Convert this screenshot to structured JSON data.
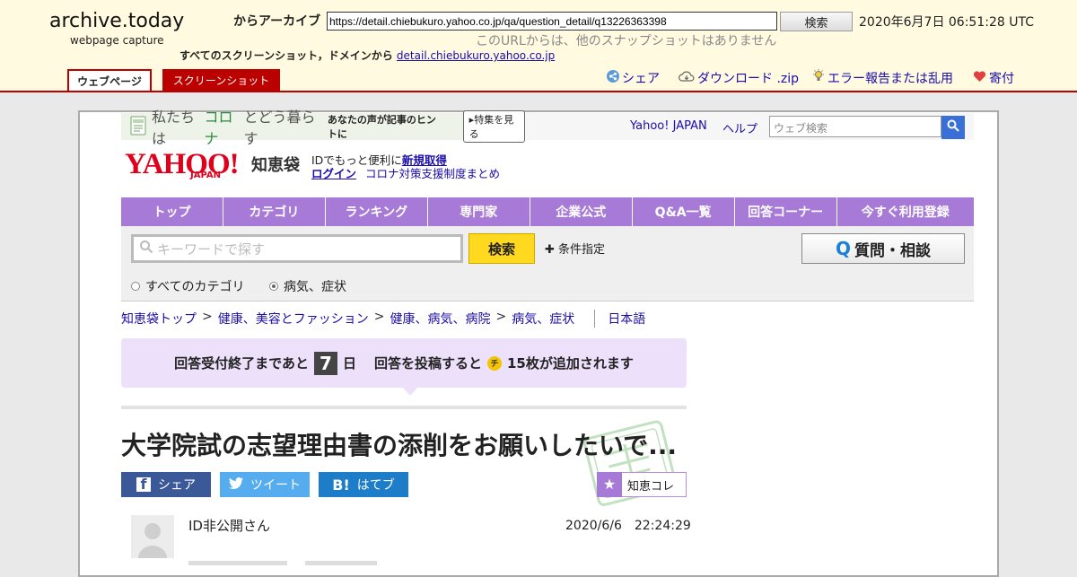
{
  "archive": {
    "logo": "archive.today",
    "logo_sub": "webpage capture",
    "from_label": "からアーカイブ",
    "url_value": "https://detail.chiebukuro.yahoo.co.jp/qa/question_detail/q13226363398",
    "search_label": "検索",
    "capture_date": "2020年6月7日 06:51:28 UTC",
    "no_other_snapshots": "このURLからは、他のスナップショットはありません",
    "all_screenshots_label": "すべてのスクリーンショット，ドメインから",
    "domain_link": "detail.chiebukuro.yahoo.co.jp",
    "tab_webpage": "ウェブページ",
    "tab_screenshot": "スクリーンショット",
    "actions": {
      "share": "シェア",
      "download": "ダウンロード .zip",
      "report": "エラー報告または乱用",
      "donate": "寄付"
    }
  },
  "yahoo": {
    "corona_banner": {
      "prefix": "私たちは",
      "corona": "コロナ",
      "middle": "とどう暮らす",
      "tail": "あなたの声が記事のヒントに",
      "button": "▸特集を見る"
    },
    "top_links": {
      "yahoo_japan": "Yahoo! JAPAN",
      "help": "ヘルプ"
    },
    "web_search_placeholder": "ウェブ検索",
    "logo": "YAHOO!",
    "logo_japan": "JAPAN",
    "brand": "知恵袋",
    "id_line_text": "IDでもっと便利に",
    "id_register": "新規取得",
    "login": "ログイン",
    "corona_support": "コロナ対策支援制度まとめ",
    "nav": [
      "トップ",
      "カテゴリ",
      "ランキング",
      "専門家",
      "企業公式",
      "Q&A一覧",
      "回答コーナー",
      "今すぐ利用登録"
    ],
    "keyword_placeholder": "キーワードで探す",
    "search_button": "検索",
    "condition": "条件指定",
    "ask_button": "質問・相談",
    "radio_all": "すべてのカテゴリ",
    "radio_current": "病気、症状",
    "breadcrumb": [
      "知恵袋トップ",
      "健康、美容とファッション",
      "健康、病気、病院",
      "病気、症状"
    ],
    "language": "日本語",
    "deadline": {
      "before": "回答受付終了まであと",
      "days": "7",
      "after": "日",
      "post_text": "回答を投稿すると",
      "chip_icon": "チ",
      "reward": "15枚が追加されます"
    },
    "question_title": "大学院試の志望理由書の添削をお願いしたいで...",
    "share": {
      "facebook": "シェア",
      "twitter": "ツイート",
      "hatena": "はてブ"
    },
    "chiekore": "知恵コレ",
    "user": "ID非公開さん",
    "date": "2020/6/6　22:24:29"
  },
  "colors": {
    "archive_bg": "#fffae0",
    "archive_red": "#bb0000",
    "nav_purple": "#a67ad6",
    "deadline_bg": "#ece0fa",
    "search_yellow": "#ffd920"
  }
}
